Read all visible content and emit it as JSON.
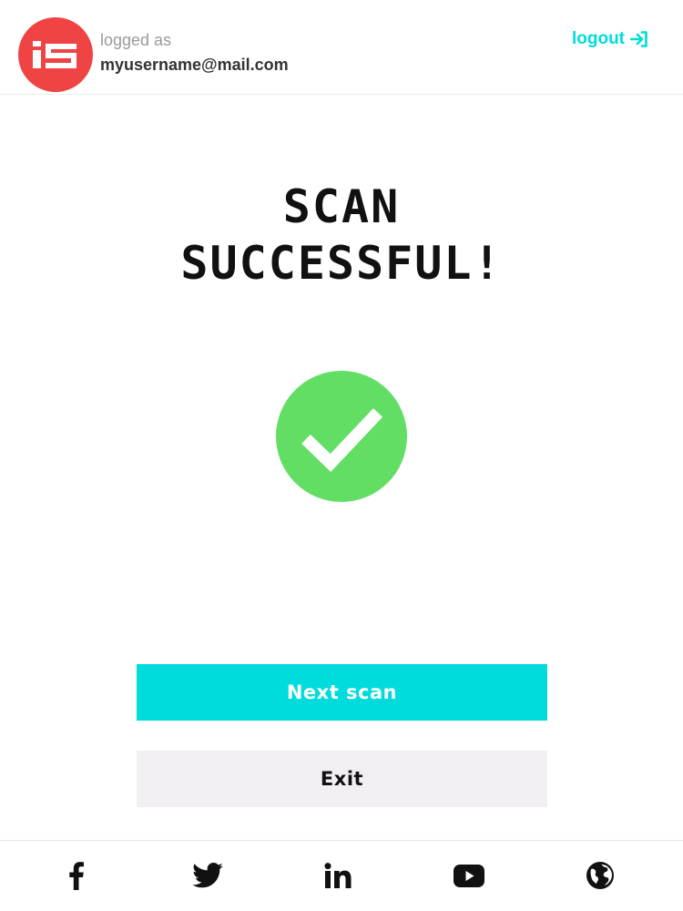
{
  "header": {
    "logged_as_label": "logged as",
    "user_email": "myusername@mail.com",
    "logout_label": "logout"
  },
  "main": {
    "title_line1": "SCAN",
    "title_line2": "SUCCESSFUL!",
    "next_label": "Next scan",
    "exit_label": "Exit"
  },
  "footer": {
    "icons": [
      "facebook-icon",
      "twitter-icon",
      "linkedin-icon",
      "youtube-icon",
      "globe-icon"
    ]
  },
  "colors": {
    "brand_red": "#f04343",
    "accent_cyan": "#00dcdc",
    "success_green": "#62de65",
    "exit_bg": "#f1eff2",
    "text_dark": "#111111"
  }
}
